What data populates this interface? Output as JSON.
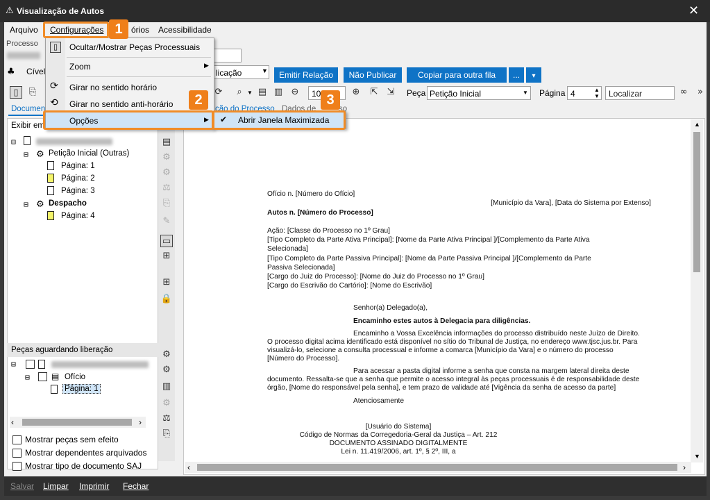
{
  "window": {
    "title": "Visualização de Autos"
  },
  "menubar": {
    "items": [
      "Arquivo",
      "Configurações",
      "órios",
      "Acessibilidade"
    ]
  },
  "header": {
    "processo_label": "Processo",
    "class_label": "Cível",
    "combo_value": "licação",
    "buttons": {
      "emitir": "Emitir Relação",
      "nao_publicar": "Não Publicar",
      "copiar": "Copiar para outra fila",
      "more": "..."
    }
  },
  "toolbar": {
    "zoom_value": "10",
    "peca_label": "Peça",
    "peca_value": "Petição Inicial",
    "pagina_label": "Página",
    "pagina_value": "4",
    "localizar_placeholder": "Localizar"
  },
  "tabs": {
    "left": "Documen",
    "view1": "ção do Processo",
    "view2": "Dados de",
    "view3": "so"
  },
  "left_panel": {
    "filter_value": "Exibir em",
    "tree": {
      "doc1": "Petição Inicial (Outras)",
      "pages1": [
        "Página: 1",
        "Página: 2",
        "Página: 3"
      ],
      "doc2": "Despacho",
      "pages2": [
        "Página: 4"
      ]
    },
    "pending_title": "Peças aguardando liberação",
    "pending": {
      "doc": "Ofício",
      "page": "Página: 1"
    },
    "checks": [
      "Mostrar peças sem efeito",
      "Mostrar dependentes arquivados",
      "Mostrar tipo de documento SAJ"
    ]
  },
  "config_menu": {
    "items": [
      "Ocultar/Mostrar Peças Processuais",
      "Zoom",
      "Girar no sentido horário",
      "Girar no sentido anti-horário",
      "Opções"
    ]
  },
  "submenu": {
    "item": "Abrir Janela Maximizada",
    "checked": true
  },
  "badges": [
    "1",
    "2",
    "3"
  ],
  "document": {
    "l1": "Ofício n. [Número do Ofício]",
    "l2": "[Município da Vara], [Data do Sistema por Extenso]",
    "l3": "Autos n. [Número do Processo]",
    "l4": "Ação: [Classe do Processo no 1º Grau]",
    "l5": "[Tipo Completo da Parte Ativa Principal]: [Nome da Parte Ativa Principal ]/[Complemento da Parte Ativa",
    "l6": "Selecionada]",
    "l7": "[Tipo Completo da Parte Passiva Principal]: [Nome da Parte Passiva Principal ]/[Complemento da Parte",
    "l8": "Passiva Selecionada]",
    "l9": "[Cargo do Juiz do Processo]: [Nome do Juiz do Processo no 1º Grau]",
    "l10": "[Cargo do Escrivão do Cartório]: [Nome do Escrivão]",
    "l11": "Senhor(a) Delegado(a),",
    "l12": "Encaminho estes autos à Delegacia para diligências.",
    "l13": "Encaminho a Vossa Excelência informações do processo distribuído neste Juízo de Direito.",
    "l14": "O processo digital acima identificado está disponível no sítio do Tribunal de Justiça, no endereço www.tjsc.jus.br. Para",
    "l15": "visualizá-lo, selecione a consulta processual e informe a comarca  [Município da Vara] e o número do processo",
    "l16": "[Número do Processo].",
    "l17": "Para acessar a pasta digital informe a senha que consta na margem lateral direita deste",
    "l18": "documento. Ressalta-se que a senha que permite o acesso integral às peças processuais é de responsabilidade deste",
    "l19": "órgão, [Nome do responsável pela senha], e tem prazo de validade até [Vigência da senha de acesso da parte]",
    "l20": "Atenciosamente",
    "l21": "[Usuário do Sistema]",
    "l22": "Código de Normas da Corregedoria-Geral da Justiça – Art. 212",
    "l23": "DOCUMENTO ASSINADO DIGITALMENTE",
    "l24": "Lei n. 11.419/2006, art. 1º, § 2º, III, a"
  },
  "bottom_bar": {
    "salvar": "Salvar",
    "limpar": "Limpar",
    "imprimir": "Imprimir",
    "fechar": "Fechar"
  },
  "colors": {
    "accent": "#0f73c6",
    "highlight": "#ef7f1a",
    "menu_hover": "#cfe4f7"
  }
}
